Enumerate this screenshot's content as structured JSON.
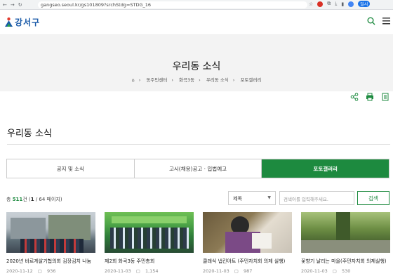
{
  "browser": {
    "url": "gangseo.seoul.kr/gs101809?srchStdg=STDG_16",
    "profile_label": "일시"
  },
  "header": {
    "logo_text": "강서구"
  },
  "hero": {
    "title": "우리동 소식",
    "breadcrumb": [
      "동주민센터",
      "화곡3동",
      "우리동 소식",
      "포토갤러리"
    ]
  },
  "section": {
    "title": "우리동 소식"
  },
  "tabs": [
    {
      "label": "공지 및 소식"
    },
    {
      "label": "고시(채용)공고 · 입법예고"
    },
    {
      "label": "포토갤러리"
    }
  ],
  "listing": {
    "prefix": "총",
    "total": "511",
    "suffix": "건",
    "page_open": "(",
    "current_page": "1",
    "page_rest": "/ 64 페이지)"
  },
  "search": {
    "select_value": "제목",
    "placeholder": "검색어를 입력해주세요.",
    "button": "검색"
  },
  "cards": [
    {
      "title": "2020년 바르게살기협의회 김장김치 나눔",
      "date": "2020-11-12",
      "views": "936"
    },
    {
      "title": "제2회 화곡3동 주민총회",
      "date": "2020-11-03",
      "views": "1,154"
    },
    {
      "title": "클래식 냅킨아트 (주민자치회 의제 실행)",
      "date": "2020-11-03",
      "views": "987"
    },
    {
      "title": "꽃향기 날리는 마을(주민자치회 의제실행)",
      "date": "2020-11-03",
      "views": "530"
    }
  ],
  "colors": {
    "accent": "#1d8a3f",
    "logo": "#1a5aa8"
  }
}
